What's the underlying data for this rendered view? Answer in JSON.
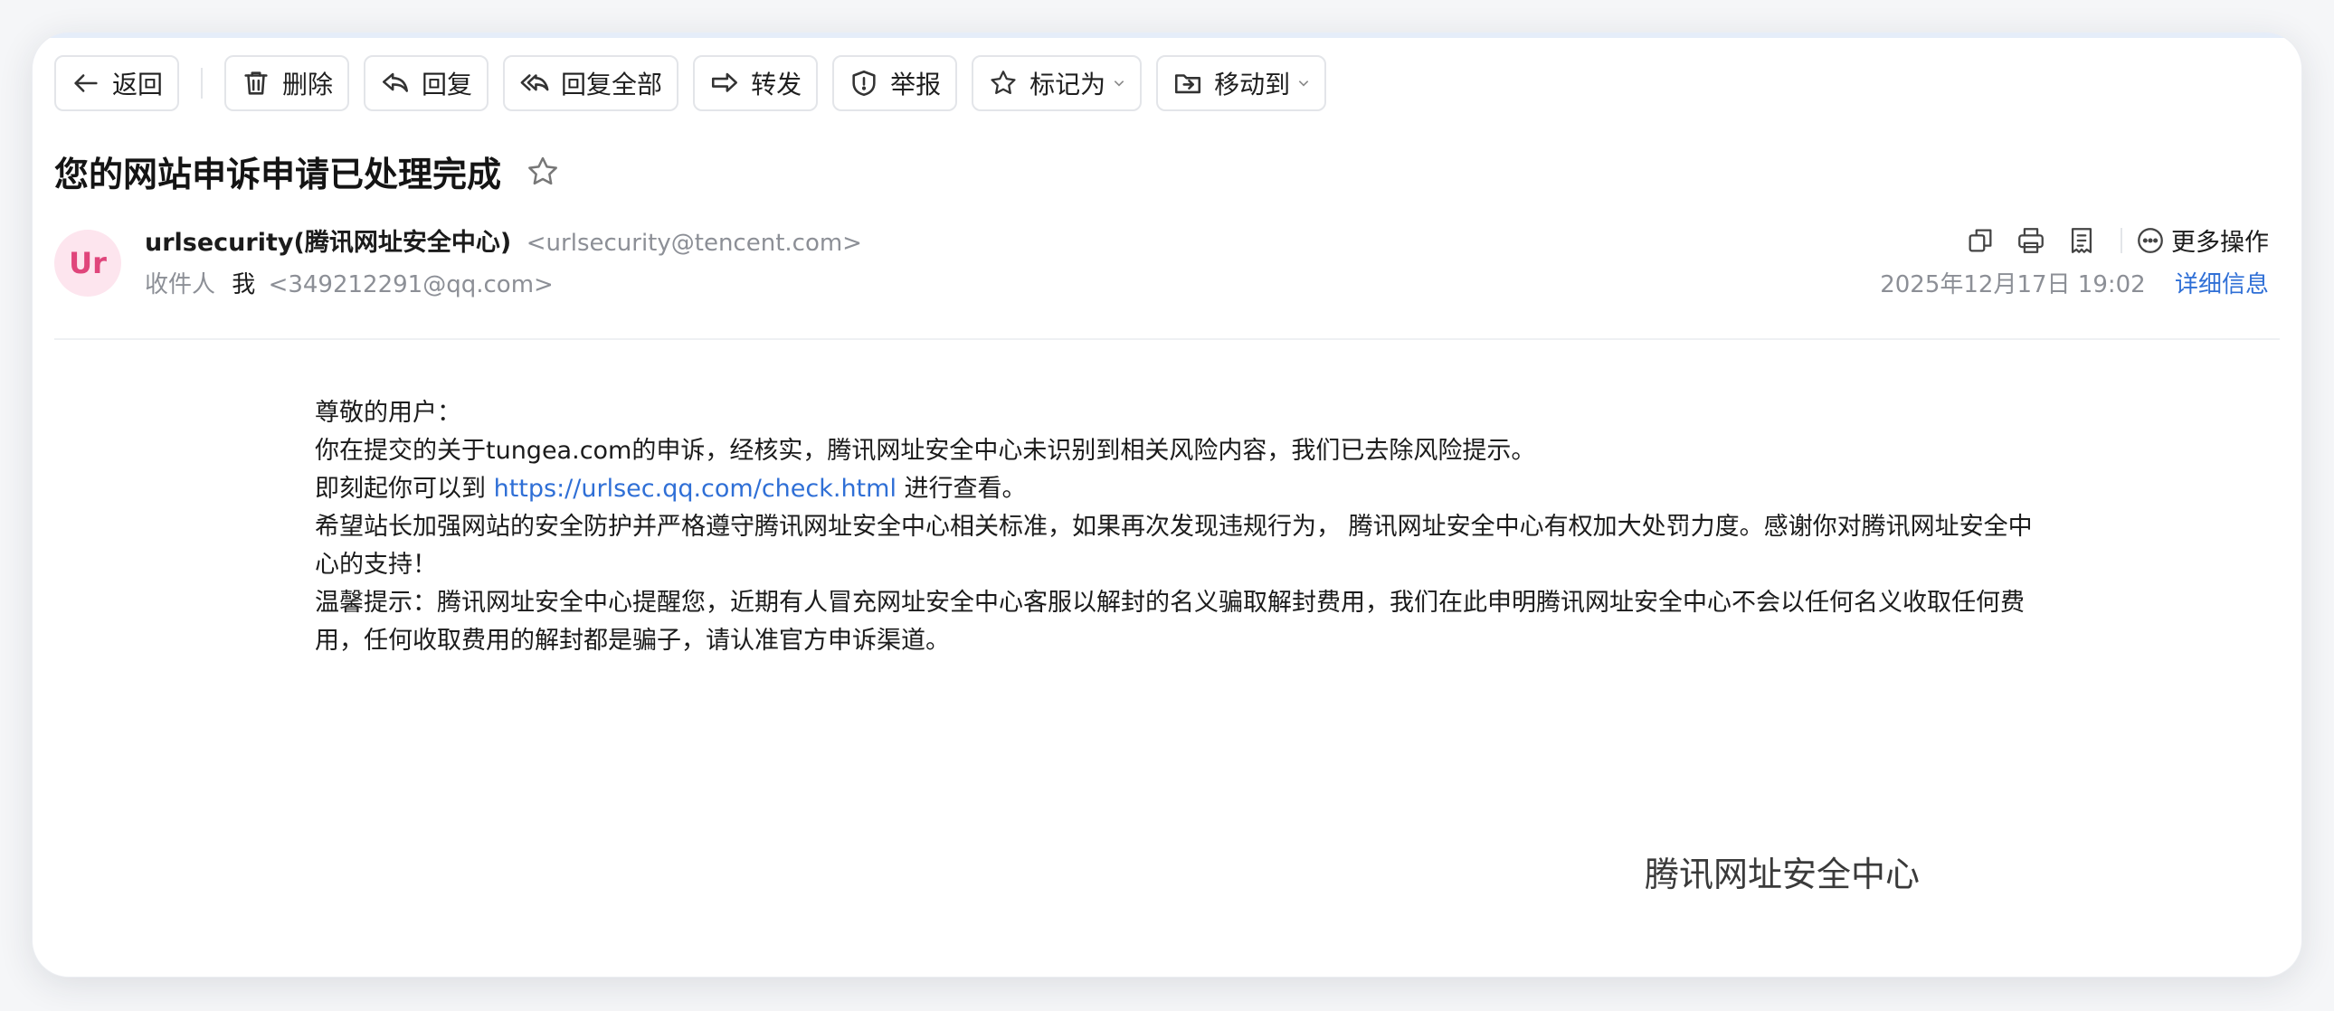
{
  "toolbar": {
    "back": "返回",
    "delete": "删除",
    "reply": "回复",
    "reply_all": "回复全部",
    "forward": "转发",
    "report": "举报",
    "mark_as": "标记为",
    "move_to": "移动到"
  },
  "mail": {
    "subject": "您的网站申诉申请已处理完成",
    "avatar_text": "Ur",
    "sender_name": "urlsecurity(腾讯网址安全中心)",
    "sender_address": "<urlsecurity@tencent.com>",
    "recipient_label": "收件人",
    "recipient_name": "我",
    "recipient_address": "<349212291@qq.com>",
    "date": "2025年12月17日 19:02",
    "detail_link": "详细信息",
    "more_actions": "更多操作"
  },
  "body": {
    "greeting": "尊敬的用户：",
    "line1": "你在提交的关于tungea.com的申诉，经核实，腾讯网址安全中心未识别到相关风险内容，我们已去除风险提示。",
    "line2_before": "即刻起你可以到 ",
    "line2_link": "https://urlsec.qq.com/check.html",
    "line2_after": " 进行查看。",
    "line3": "希望站长加强网站的安全防护并严格遵守腾讯网址安全中心相关标准，如果再次发现违规行为， 腾讯网址安全中心有权加大处罚力度。感谢你对腾讯网址安全中心的支持！",
    "line4": "温馨提示：腾讯网址安全中心提醒您，近期有人冒充网址安全中心客服以解封的名义骗取解封费用，我们在此申明腾讯网址安全中心不会以任何名义收取任何费用，任何收取费用的解封都是骗子，请认准官方申诉渠道。",
    "signature": "腾讯网址安全中心"
  },
  "colors": {
    "accent": "#2f6fd6",
    "avatar_bg": "#fde5ee",
    "avatar_fg": "#e0457b",
    "muted": "#8c8f96"
  },
  "icons": {
    "back": "arrow-left-icon",
    "delete": "trash-icon",
    "reply": "reply-icon",
    "reply_all": "reply-all-icon",
    "forward": "forward-icon",
    "report": "shield-alert-icon",
    "mark_as": "star-outline-icon",
    "move_to": "folder-move-icon",
    "subject_star": "star-icon",
    "copy": "copy-icon",
    "print": "print-icon",
    "note": "note-icon",
    "more": "more-dots-icon"
  }
}
